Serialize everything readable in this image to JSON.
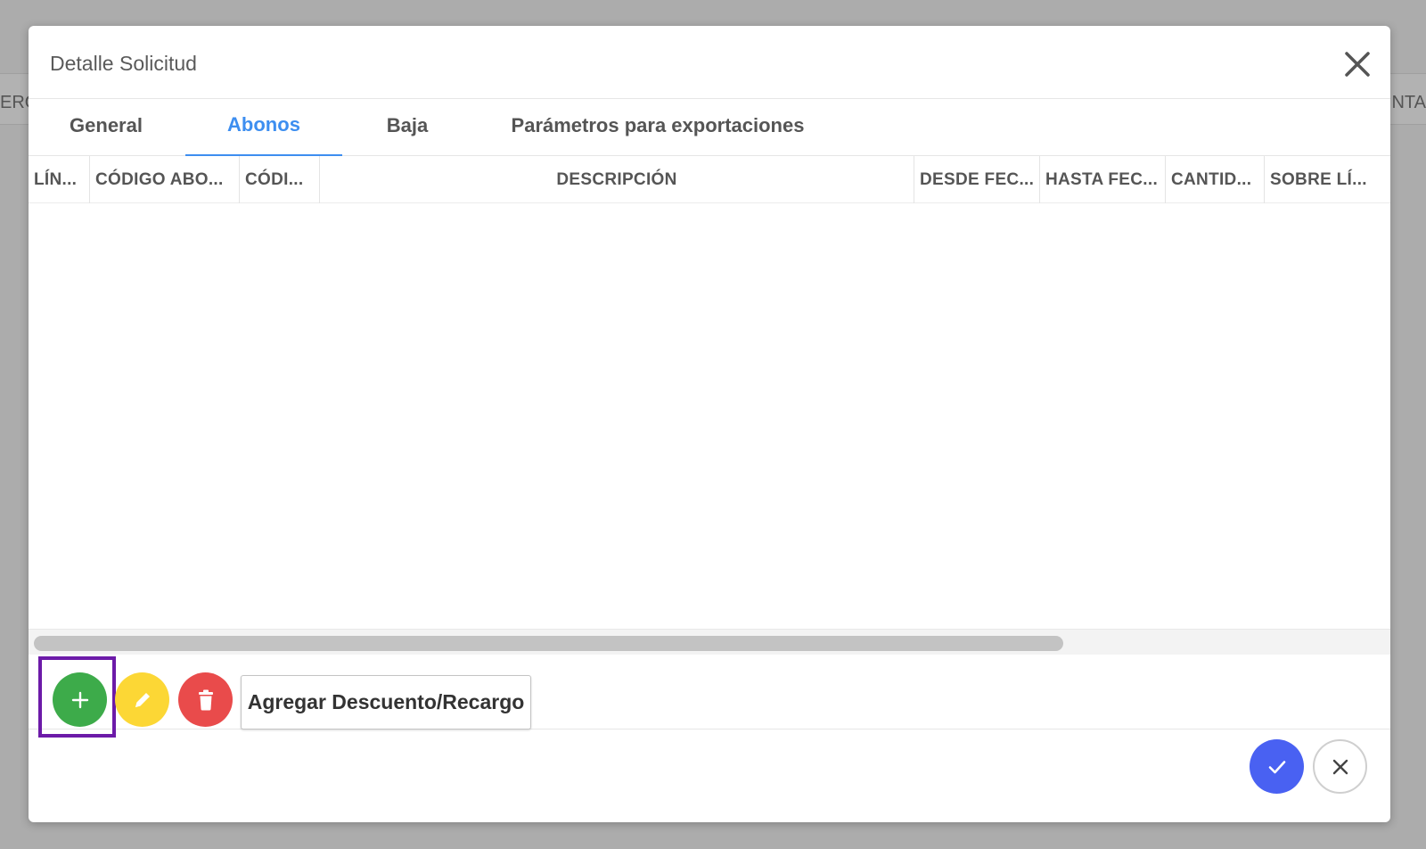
{
  "background": {
    "left_fragment": "ERO",
    "right_fragment": "NTA"
  },
  "modal": {
    "title": "Detalle Solicitud",
    "close_icon": "close-icon"
  },
  "tabs": [
    {
      "label": "General",
      "active": false
    },
    {
      "label": "Abonos",
      "active": true
    },
    {
      "label": "Baja",
      "active": false
    },
    {
      "label": "Parámetros para exportaciones",
      "active": false
    }
  ],
  "grid": {
    "columns": [
      "LÍN...",
      "CÓDIGO ABO...",
      "CÓDI...",
      "DESCRIPCIÓN",
      "DESDE FEC...",
      "HASTA FEC...",
      "CANTID...",
      "SOBRE LÍ..."
    ],
    "rows": []
  },
  "actions": {
    "add_icon": "plus-icon",
    "edit_icon": "pencil-icon",
    "delete_icon": "trash-icon",
    "discount_label": "Agregar Descuento/Recargo"
  },
  "footer": {
    "confirm_icon": "check-icon",
    "cancel_icon": "close-icon"
  },
  "colors": {
    "accent": "#3d8ef0",
    "add": "#3dab4a",
    "edit": "#fcd735",
    "delete": "#e94b4b",
    "confirm": "#4961f2",
    "highlight": "#6c1aa8"
  }
}
